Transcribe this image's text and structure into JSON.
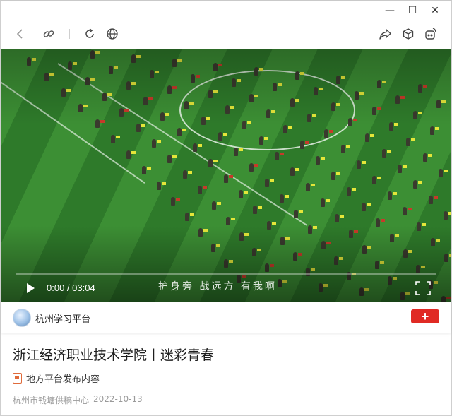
{
  "window": {
    "controls": [
      "minimize",
      "maximize",
      "close"
    ],
    "minimize_glyph": "—",
    "maximize_glyph": "☐",
    "close_glyph": "✕"
  },
  "toolbar": {
    "left": [
      "back-icon",
      "link-icon",
      "refresh-icon",
      "globe-icon"
    ],
    "right": [
      "share-icon",
      "cube-icon",
      "ai-assistant-icon"
    ]
  },
  "video": {
    "current_time": "0:00",
    "duration": "03:04",
    "time_display": "0:00 / 03:04",
    "progress": 0.0,
    "subtitle": "护身旁  战远方  有我啊"
  },
  "channel": {
    "name": "杭州学习平台",
    "follow_label": "+"
  },
  "article": {
    "title": "浙江经济职业技术学院丨迷彩青春",
    "source_label": "地方平台发布内容",
    "author": "杭州市钱塘供稿中心",
    "date": "2022-10-13"
  },
  "colors": {
    "accent_red": "#e02a24",
    "field_green": "#3c8f34",
    "source_icon": "#e06a3a"
  }
}
